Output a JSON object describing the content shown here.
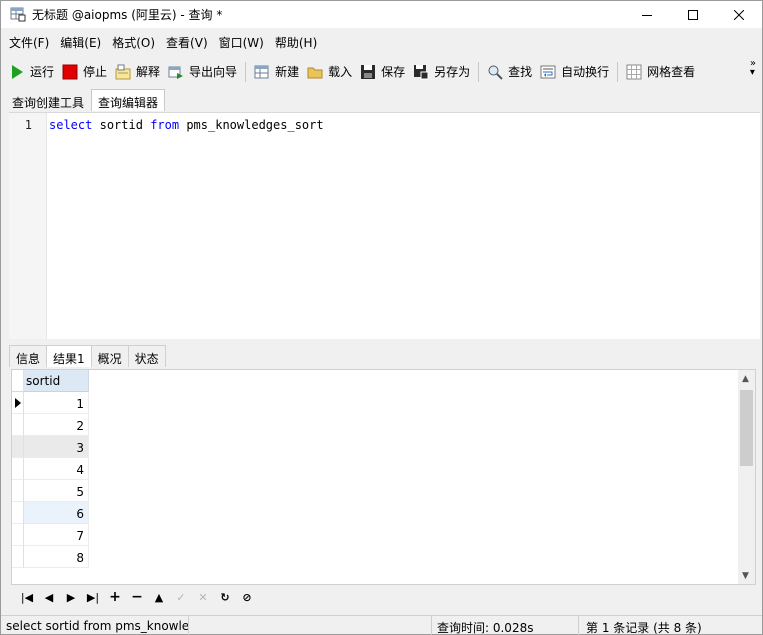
{
  "window": {
    "title": "无标题 @aiopms (阿里云) - 查询 *",
    "icon": "app-table-icon",
    "controls": [
      "minimize-icon",
      "maximize-icon",
      "close-icon"
    ]
  },
  "menubar": {
    "items": [
      "文件(F)",
      "编辑(E)",
      "格式(O)",
      "查看(V)",
      "窗口(W)",
      "帮助(H)"
    ]
  },
  "toolbar": {
    "run": "运行",
    "stop": "停止",
    "explain": "解释",
    "export_wizard": "导出向导",
    "new": "新建",
    "load": "载入",
    "save": "保存",
    "save_as": "另存为",
    "find": "查找",
    "word_wrap": "自动换行",
    "grid_view": "网格查看",
    "more": "»",
    "colors": {
      "run": "#1fa11f",
      "stop": "#e00000"
    }
  },
  "editor_tabs": [
    "查询创建工具",
    "查询编辑器"
  ],
  "editor": {
    "line_number": "1",
    "code": {
      "kw1": "select",
      "col": "sortid",
      "kw2": "from",
      "table": "pms_knowledges_sort"
    },
    "colors": {
      "keyword": "#0000ff"
    }
  },
  "result_tabs": [
    "信息",
    "结果1",
    "概况",
    "状态"
  ],
  "grid": {
    "column": "sortid",
    "rows": [
      "1",
      "2",
      "3",
      "4",
      "5",
      "6",
      "7",
      "8"
    ],
    "current_row": 0,
    "colors": {
      "header": "#dce9f5",
      "selected_row": "#eaeaea",
      "alt_row": "#eaf3fc"
    }
  },
  "navbar": {
    "buttons": [
      "first-icon",
      "prev-icon",
      "next-icon",
      "last-icon",
      "add-icon",
      "delete-icon",
      "up-icon",
      "apply-icon",
      "cancel-icon",
      "refresh-icon",
      "stop-icon"
    ]
  },
  "statusbar": {
    "sql": "select sortid from pms_knowle",
    "query_time": "查询时间: 0.028s",
    "record": "第 1 条记录 (共 8 条)"
  }
}
